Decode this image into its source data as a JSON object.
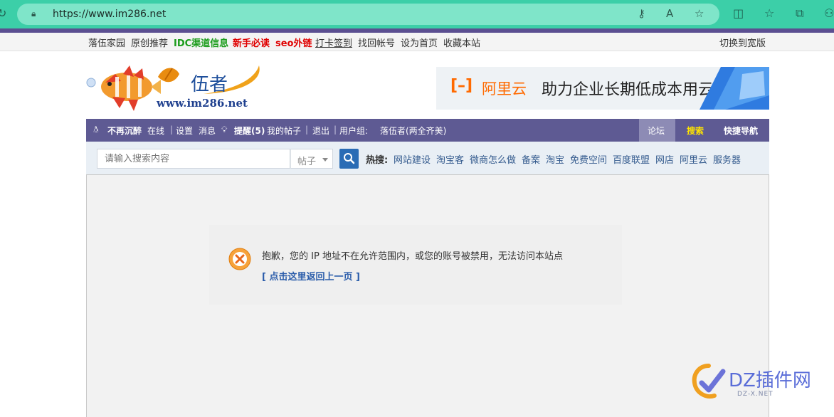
{
  "browser": {
    "url": "https://www.im286.net",
    "colors": {
      "bar": "#3ccfa8",
      "pill": "#7fe5c9",
      "strip": "#5b4f91"
    }
  },
  "topbar": {
    "links": [
      "落伍家园",
      "原创推荐",
      "IDC渠道信息",
      "新手必读",
      "seo外链",
      "打卡签到",
      "找回帐号",
      "设为首页",
      "收藏本站"
    ],
    "right_link": "切换到宽版"
  },
  "header": {
    "logo_name": "伍者",
    "logo_url": "www.im286.net",
    "banner_brand": "阿里云",
    "banner_tagline": "助力企业长期低成本用云"
  },
  "navbar": {
    "username": "不再沉醉",
    "status": "在线",
    "settings": "设置",
    "messages": "消息",
    "reminders": "提醒(5)",
    "my_posts": "我的帖子",
    "logout": "退出",
    "usergroup_label": "用户组:",
    "usergroup": "落伍者(两全齐美)",
    "forum": "论坛",
    "search": "搜索",
    "quick_nav": "快捷导航"
  },
  "search": {
    "placeholder": "请输入搜索内容",
    "type": "帖子",
    "hot_label": "热搜:",
    "hot_terms": [
      "网站建设",
      "淘宝客",
      "微商怎么做",
      "备案",
      "淘宝",
      "免费空间",
      "百度联盟",
      "网店",
      "阿里云",
      "服务器"
    ]
  },
  "alert": {
    "message": "抱歉，您的 IP 地址不在允许范围内，或您的账号被禁用，无法访问本站点",
    "back_link": "[ 点击这里返回上一页 ]"
  },
  "watermark": {
    "text": "DZ插件网",
    "sub": "DZ-X.NET"
  }
}
